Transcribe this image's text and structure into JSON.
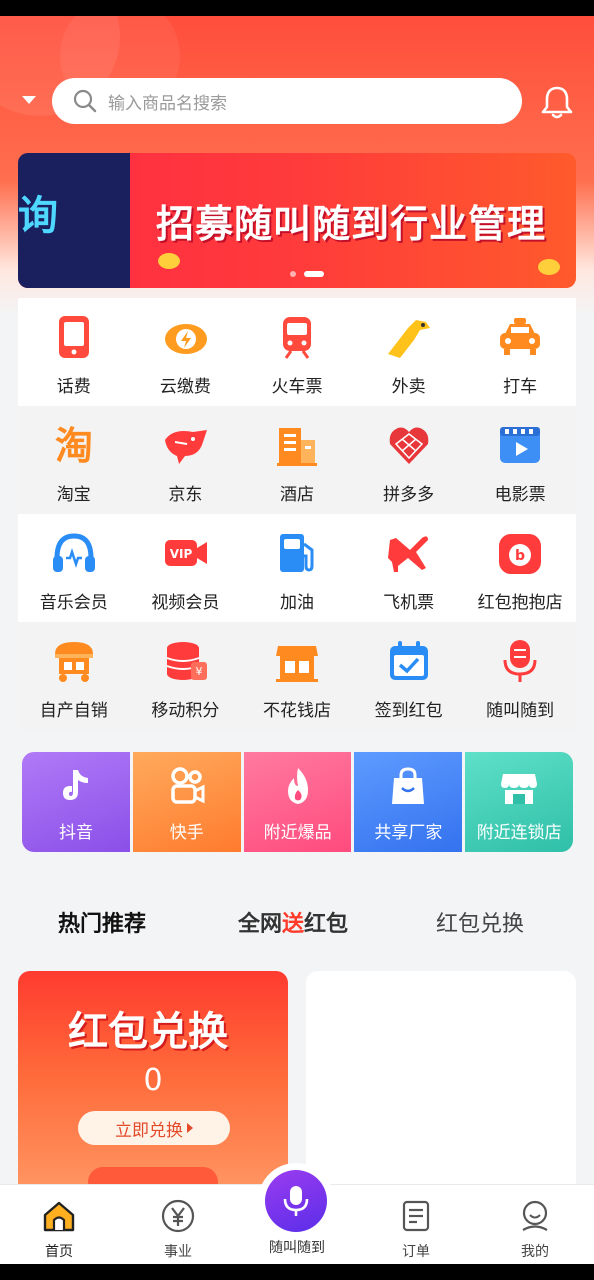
{
  "search": {
    "placeholder": "输入商品名搜索"
  },
  "banner": {
    "left_text": "询",
    "title": "招募随叫随到行业管理",
    "slides": 2,
    "active_slide": 2
  },
  "services": [
    [
      {
        "label": "话费",
        "icon": "phone-icon"
      },
      {
        "label": "云缴费",
        "icon": "cloud-bolt-icon"
      },
      {
        "label": "火车票",
        "icon": "train-icon"
      },
      {
        "label": "外卖",
        "icon": "kangaroo-icon"
      },
      {
        "label": "打车",
        "icon": "taxi-icon"
      }
    ],
    [
      {
        "label": "淘宝",
        "icon": "taobao-icon"
      },
      {
        "label": "京东",
        "icon": "jd-dog-icon"
      },
      {
        "label": "酒店",
        "icon": "hotel-icon"
      },
      {
        "label": "拼多多",
        "icon": "pinduoduo-icon"
      },
      {
        "label": "电影票",
        "icon": "movie-ticket-icon"
      }
    ],
    [
      {
        "label": "音乐会员",
        "icon": "headphones-icon"
      },
      {
        "label": "视频会员",
        "icon": "vip-video-icon"
      },
      {
        "label": "加油",
        "icon": "fuel-pump-icon"
      },
      {
        "label": "飞机票",
        "icon": "airplane-icon"
      },
      {
        "label": "红包抱抱店",
        "icon": "red-packet-store-icon"
      }
    ],
    [
      {
        "label": "自产自销",
        "icon": "market-stall-icon"
      },
      {
        "label": "移动积分",
        "icon": "coins-stack-icon"
      },
      {
        "label": "不花钱店",
        "icon": "free-store-icon"
      },
      {
        "label": "签到红包",
        "icon": "calendar-check-icon"
      },
      {
        "label": "随叫随到",
        "icon": "microphone-icon"
      }
    ]
  ],
  "promo": [
    {
      "label": "抖音",
      "icon": "tiktok-icon",
      "color": "#9b5cf0"
    },
    {
      "label": "快手",
      "icon": "kuaishou-icon",
      "color": "#ff8a3d"
    },
    {
      "label": "附近爆品",
      "icon": "flame-icon",
      "color": "#ff5b8a"
    },
    {
      "label": "共享厂家",
      "icon": "shopping-bag-icon",
      "color": "#3d82f5"
    },
    {
      "label": "附近连锁店",
      "icon": "shop-awning-icon",
      "color": "#3cc6b0"
    }
  ],
  "tabs": {
    "hot": "热门推荐",
    "net_prefix": "全网",
    "net_red": "送",
    "net_suffix": "红包",
    "exchange": "红包兑换"
  },
  "exchange_card": {
    "title": "红包兑换",
    "count": "0",
    "button": "立即兑换"
  },
  "tabbar": {
    "home": "首页",
    "business": "事业",
    "call": "随叫随到",
    "orders": "订单",
    "mine": "我的"
  },
  "colors": {
    "brand": "#ff4e3c",
    "accent_purple": "#6a2ee8"
  }
}
